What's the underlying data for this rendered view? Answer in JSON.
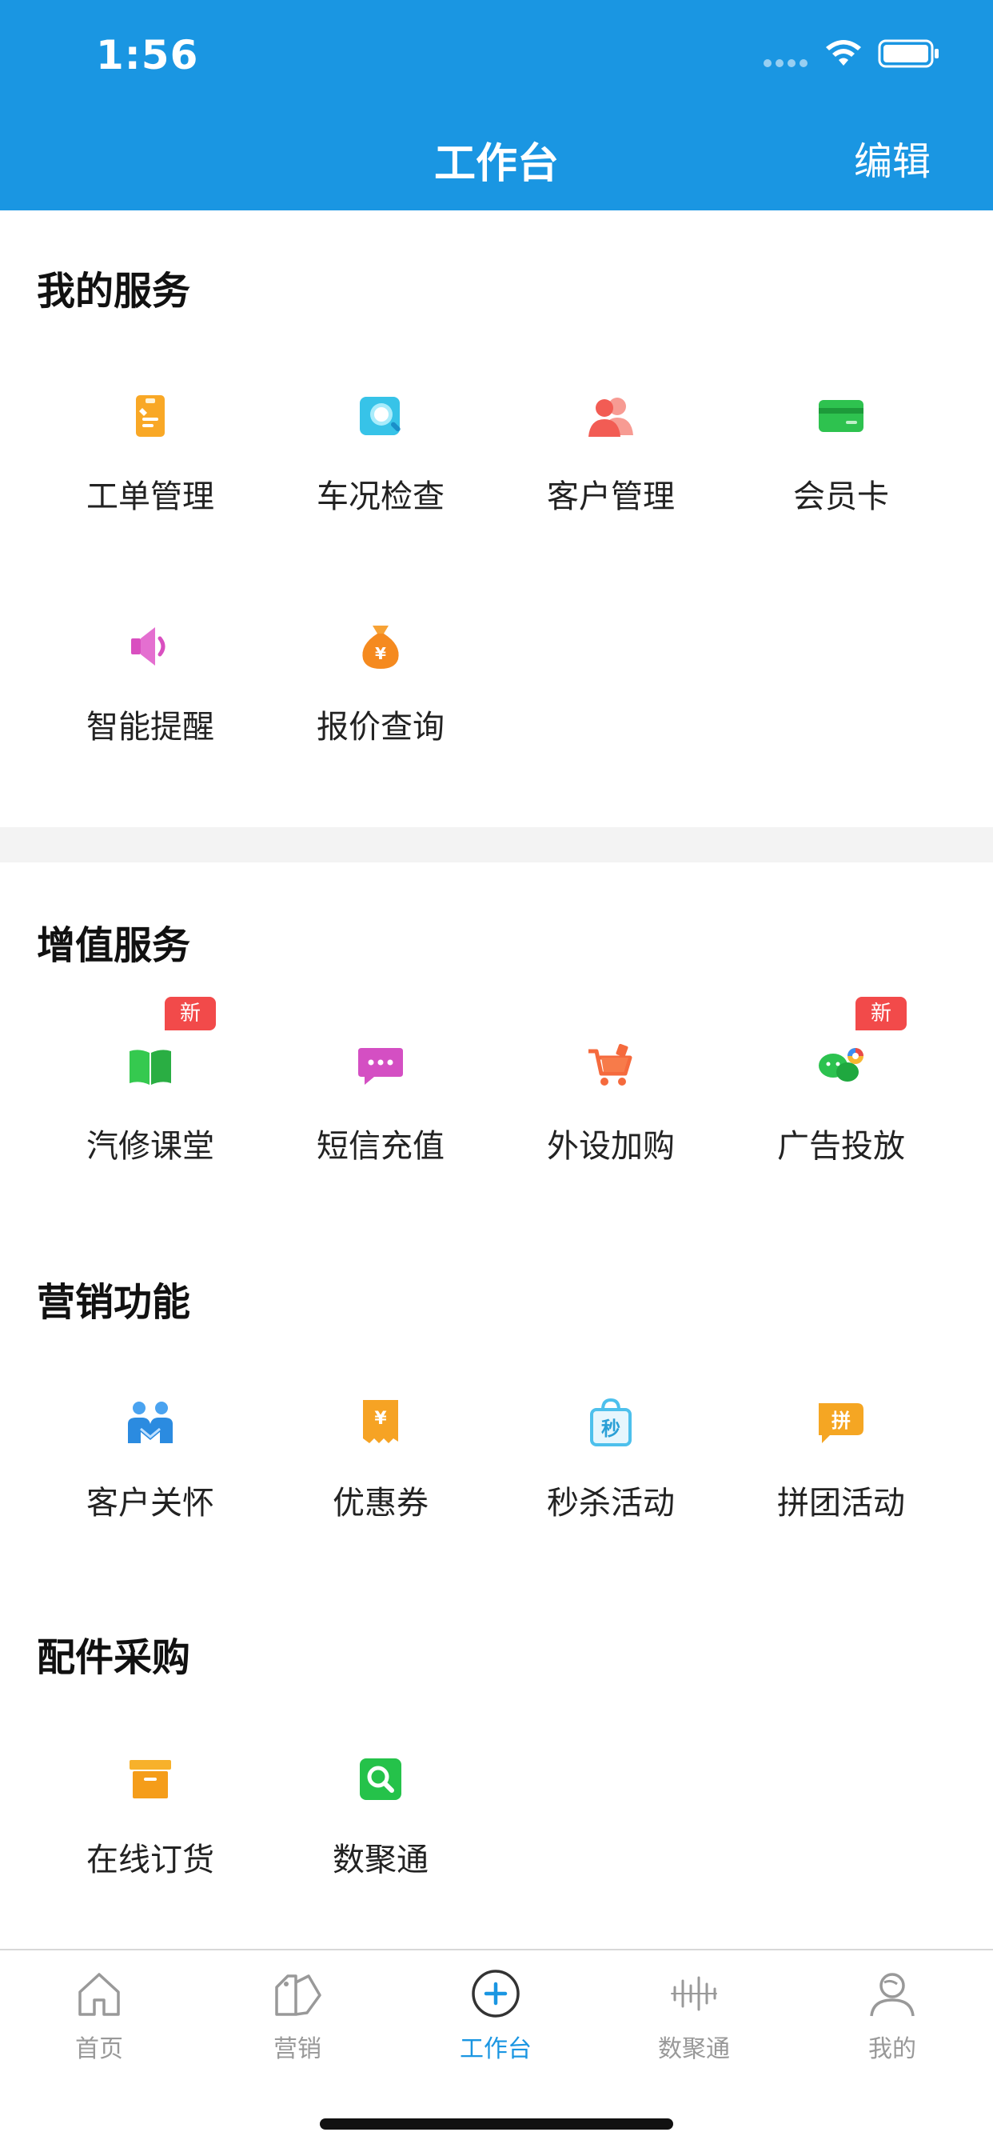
{
  "status_bar": {
    "time": "1:56"
  },
  "header": {
    "title": "工作台",
    "edit_label": "编辑"
  },
  "sections": {
    "my_services": {
      "title": "我的服务",
      "items": [
        {
          "label": "工单管理",
          "icon": "work-order-icon"
        },
        {
          "label": "车况检查",
          "icon": "inspection-icon"
        },
        {
          "label": "客户管理",
          "icon": "customers-icon"
        },
        {
          "label": "会员卡",
          "icon": "member-card-icon"
        },
        {
          "label": "智能提醒",
          "icon": "speaker-icon"
        },
        {
          "label": "报价查询",
          "icon": "money-bag-icon"
        }
      ]
    },
    "value_added": {
      "title": "增值服务",
      "items": [
        {
          "label": "汽修课堂",
          "icon": "book-icon",
          "badge": "新"
        },
        {
          "label": "短信充值",
          "icon": "message-icon"
        },
        {
          "label": "外设加购",
          "icon": "cart-icon"
        },
        {
          "label": "广告投放",
          "icon": "wechat-ad-icon",
          "badge": "新"
        }
      ]
    },
    "marketing": {
      "title": "营销功能",
      "items": [
        {
          "label": "客户关怀",
          "icon": "customer-care-icon"
        },
        {
          "label": "优惠券",
          "icon": "coupon-icon"
        },
        {
          "label": "秒杀活动",
          "icon": "flash-sale-bag-icon",
          "icon_text": "秒"
        },
        {
          "label": "拼团活动",
          "icon": "group-buy-icon",
          "icon_text": "拼"
        }
      ]
    },
    "parts": {
      "title": "配件采购",
      "items": [
        {
          "label": "在线订货",
          "icon": "order-box-icon"
        },
        {
          "label": "数聚通",
          "icon": "search-icon"
        }
      ]
    }
  },
  "tabbar": {
    "items": [
      {
        "label": "首页",
        "icon": "home-icon",
        "active": false
      },
      {
        "label": "营销",
        "icon": "tag-icon",
        "active": false
      },
      {
        "label": "工作台",
        "icon": "plus-circle-icon",
        "active": true
      },
      {
        "label": "数聚通",
        "icon": "bars-icon",
        "active": false
      },
      {
        "label": "我的",
        "icon": "user-icon",
        "active": false
      }
    ]
  },
  "colors": {
    "brand": "#1a96e2",
    "badge": "#f24a4a",
    "tab_inactive": "#999999",
    "section_gap": "#f3f3f3"
  }
}
